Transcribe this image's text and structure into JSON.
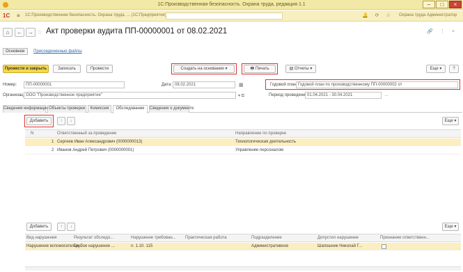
{
  "window": {
    "title": "1С:Производственная безопасность. Охрана труда, редакция 1.1",
    "minimize": "–",
    "maximize": "□",
    "close": "×"
  },
  "topbar": {
    "logo": "1С",
    "menu": "≡",
    "app_title": "1С:Производственная безопасность. Охрана труда, ... (1С:Предприятие)",
    "search_placeholder": "",
    "icons": "🔔 ⟳ ☆",
    "user": "Охрана труда Администратор"
  },
  "nav": {
    "back": "←",
    "forward": "→",
    "star": "☆",
    "title": "Акт проверки аудита ПП-00000001 от 08.02.2021",
    "right_icons": "🔗 ⋮ ×"
  },
  "tabs": {
    "main": "Основное",
    "linked": "Присоединенные файлы"
  },
  "toolbar": {
    "post_close": "Провести и закрыть",
    "save": "Записать",
    "post": "Провести",
    "create_basis": "Создать на основании ▾",
    "print": "🖶 Печать",
    "reports": "▤ Отчеты ▾",
    "more": "Еще ▾",
    "help": "?"
  },
  "form": {
    "number_label": "Номер:",
    "number_value": "ПП-00000001",
    "date_label": "Дата:",
    "date_value": "08.02.2021",
    "plan_label": "Годовой план:",
    "plan_value": "Годовой план по производственному ПП-00000002 от",
    "org_label": "Организация:",
    "org_value": "ООО \"Производственное предприятие\"",
    "period_label": "Период проведения:",
    "period_value": "01.04.2021 - 30.04.2021"
  },
  "doc_tabs": [
    "Сведения информации",
    "Объекты проверки",
    "Комиссия",
    "Обследование",
    "Сведения о документе"
  ],
  "top_grid": {
    "add_label": "Добавить",
    "up": "↑",
    "down": "↓",
    "more": "Еще ▾",
    "columns": [
      "N",
      "Ответственный за проведение",
      "Направление по проверке"
    ],
    "rows": [
      [
        "1",
        "Сергеев Иван Александрович (0000000013)",
        "Технологическая деятельность"
      ],
      [
        "2",
        "Иванов Андрей Петрович (0000000001)",
        "Управление персоналом"
      ]
    ]
  },
  "bottom_grid": {
    "add_label": "Добавить",
    "up": "↑",
    "down": "↓",
    "more": "Еще ▾",
    "columns": [
      "Вид нарушения",
      "Результат обследо...",
      "Нарушение требован...",
      "Практическая работа",
      "Подразделение",
      "Допустил нарушение",
      "Признание ответственн..."
    ],
    "rows": [
      [
        "Нарушение вспомогательн...",
        "Грубое нарушение ...",
        "п. 1.10. 115",
        "",
        "Административное",
        "Шапошник Николай Г...",
        ""
      ]
    ]
  },
  "colors": {
    "accent": "#f5d84c",
    "highlight": "#e03131",
    "selected_row": "#fbeec0"
  }
}
